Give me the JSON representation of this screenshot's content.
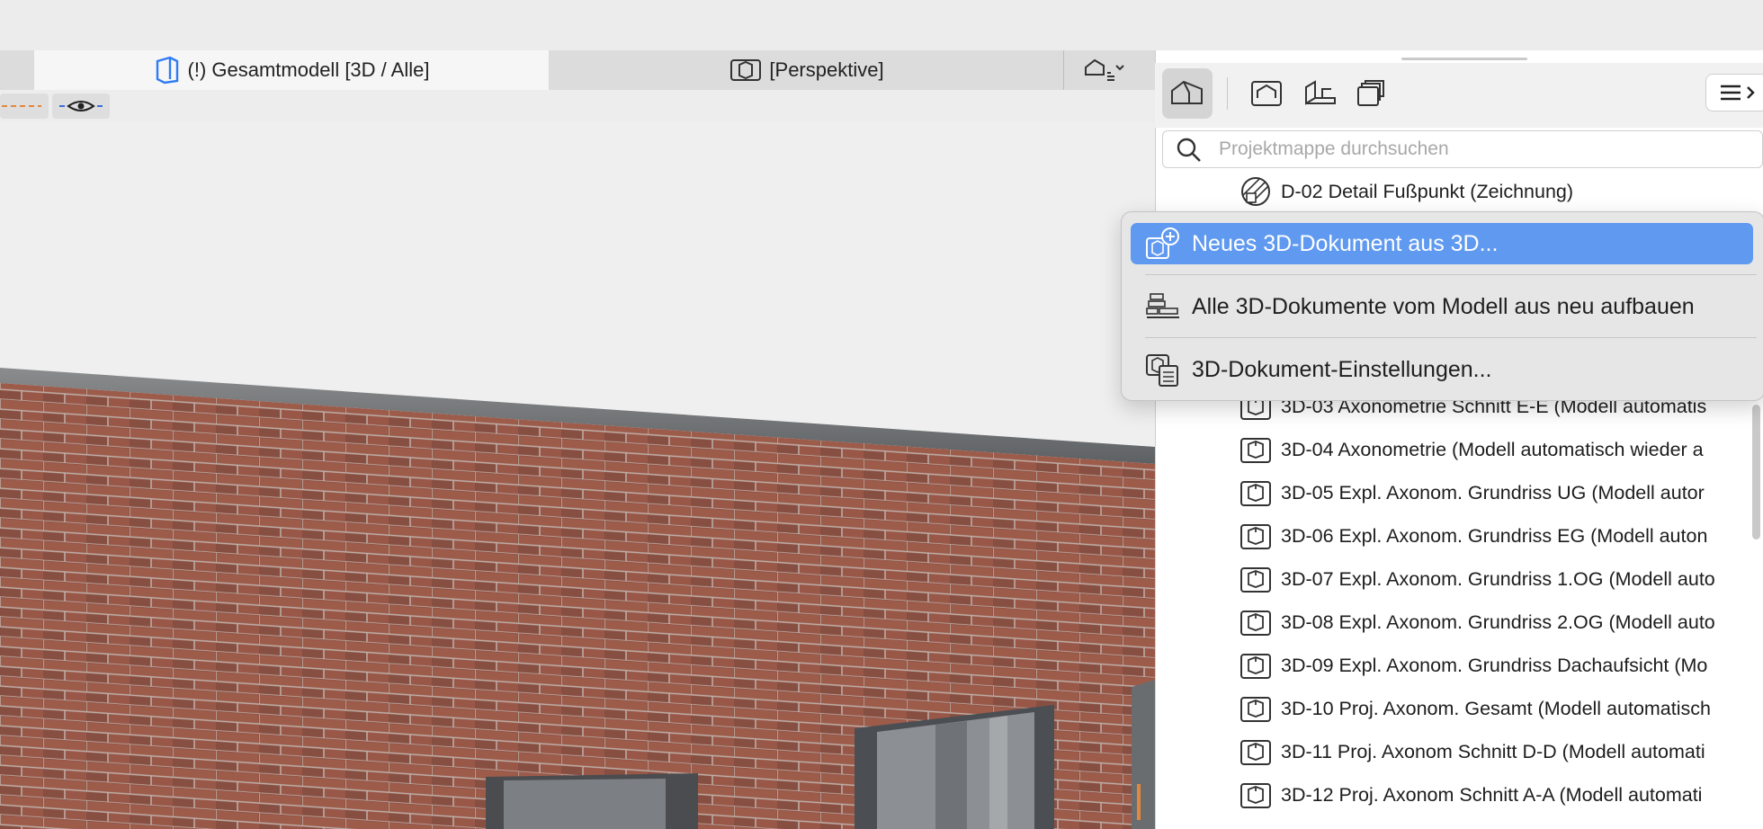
{
  "tabs": {
    "active": "(!) Gesamtmodell [3D / Alle]",
    "second": "[Perspektive]"
  },
  "search": {
    "placeholder": "Projektmappe durchsuchen"
  },
  "list": {
    "top_item": "D-02 Detail Fußpunkt (Zeichnung)",
    "items": [
      "3D-03 Axonometrie Schnitt E-E (Modell automatis",
      "3D-04 Axonometrie (Modell automatisch wieder a",
      "3D-05 Expl. Axonom. Grundriss UG (Modell autor",
      "3D-06 Expl. Axonom. Grundriss EG (Modell auton",
      "3D-07 Expl. Axonom. Grundriss 1.OG (Modell auto",
      "3D-08 Expl. Axonom. Grundriss 2.OG (Modell auto",
      "3D-09 Expl. Axonom. Grundriss Dachaufsicht (Mo",
      "3D-10 Proj. Axonom. Gesamt (Modell automatisch",
      "3D-11 Proj. Axonom Schnitt D-D (Modell automati",
      "3D-12 Proj. Axonom Schnitt A-A (Modell automati"
    ]
  },
  "context_menu": {
    "items": [
      "Neues 3D-Dokument aus 3D...",
      "Alle 3D-Dokumente vom Modell aus neu aufbauen",
      "3D-Dokument-Einstellungen..."
    ]
  },
  "colors": {
    "menu_highlight": "#5f99f0",
    "brick": "#9a5a4c",
    "roof_edge": "#6f7173"
  },
  "icons": [
    "model-3d-icon",
    "perspective-icon",
    "view-options-icon",
    "eye-icon",
    "search-icon",
    "menu-icon",
    "drawing-icon",
    "document-3d-icon",
    "new-3d-document-icon",
    "rebuild-icon",
    "document-settings-icon"
  ]
}
